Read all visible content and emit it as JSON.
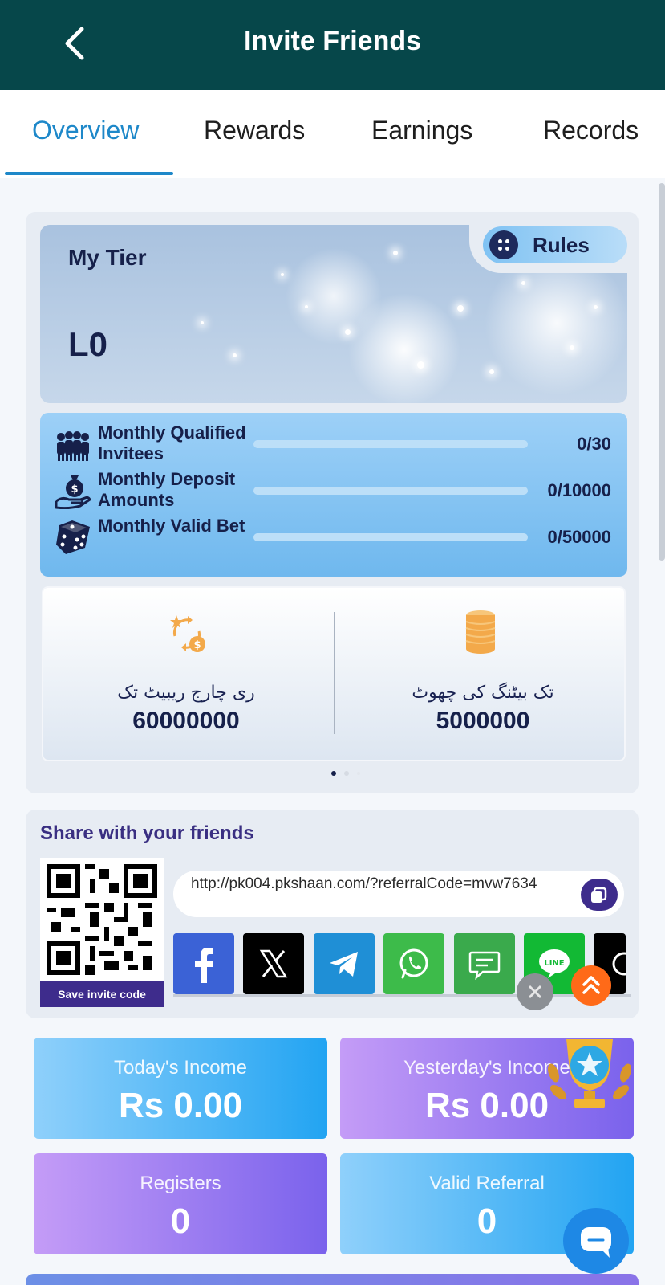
{
  "header": {
    "title": "Invite Friends"
  },
  "tabs": [
    {
      "label": "Overview",
      "active": true
    },
    {
      "label": "Rewards"
    },
    {
      "label": "Earnings"
    },
    {
      "label": "Records"
    }
  ],
  "tier": {
    "label": "My Tier",
    "value": "L0",
    "rules_label": "Rules"
  },
  "progress": [
    {
      "label": "Monthly Qualified Invitees",
      "value": "0/30",
      "fraction": 0,
      "icon": "group-icon"
    },
    {
      "label": "Monthly Deposit Amounts",
      "value": "0/10000",
      "fraction": 0,
      "icon": "money-bag-hand-icon"
    },
    {
      "label": "Monthly Valid Bet",
      "value": "0/50000",
      "fraction": 0,
      "icon": "dice-icon"
    }
  ],
  "rebates": [
    {
      "label": "ری چارج ریبیٹ تک",
      "value": "60000000",
      "icon": "recharge-rebate-icon"
    },
    {
      "label": "تک بیٹنگ کی چھوٹ",
      "value": "5000000",
      "icon": "coin-stack-icon"
    }
  ],
  "pager": {
    "count": 3,
    "active": 0
  },
  "share": {
    "title": "Share with your friends",
    "save_label": "Save invite code",
    "link": "http://pk004.pkshaan.com/?referralCode=mvw7634",
    "networks": [
      "facebook",
      "x",
      "telegram",
      "whatsapp",
      "sms",
      "line",
      "threads"
    ]
  },
  "stats": [
    {
      "label": "Today's Income",
      "value": "Rs 0.00"
    },
    {
      "label": "Yesterday's Income",
      "value": "Rs 0.00"
    },
    {
      "label": "Registers",
      "value": "0"
    },
    {
      "label": "Valid Referral",
      "value": "0"
    }
  ],
  "colors": {
    "header": "#06474a",
    "accent": "#1e88c9",
    "brand_purple": "#3e2c8c"
  }
}
